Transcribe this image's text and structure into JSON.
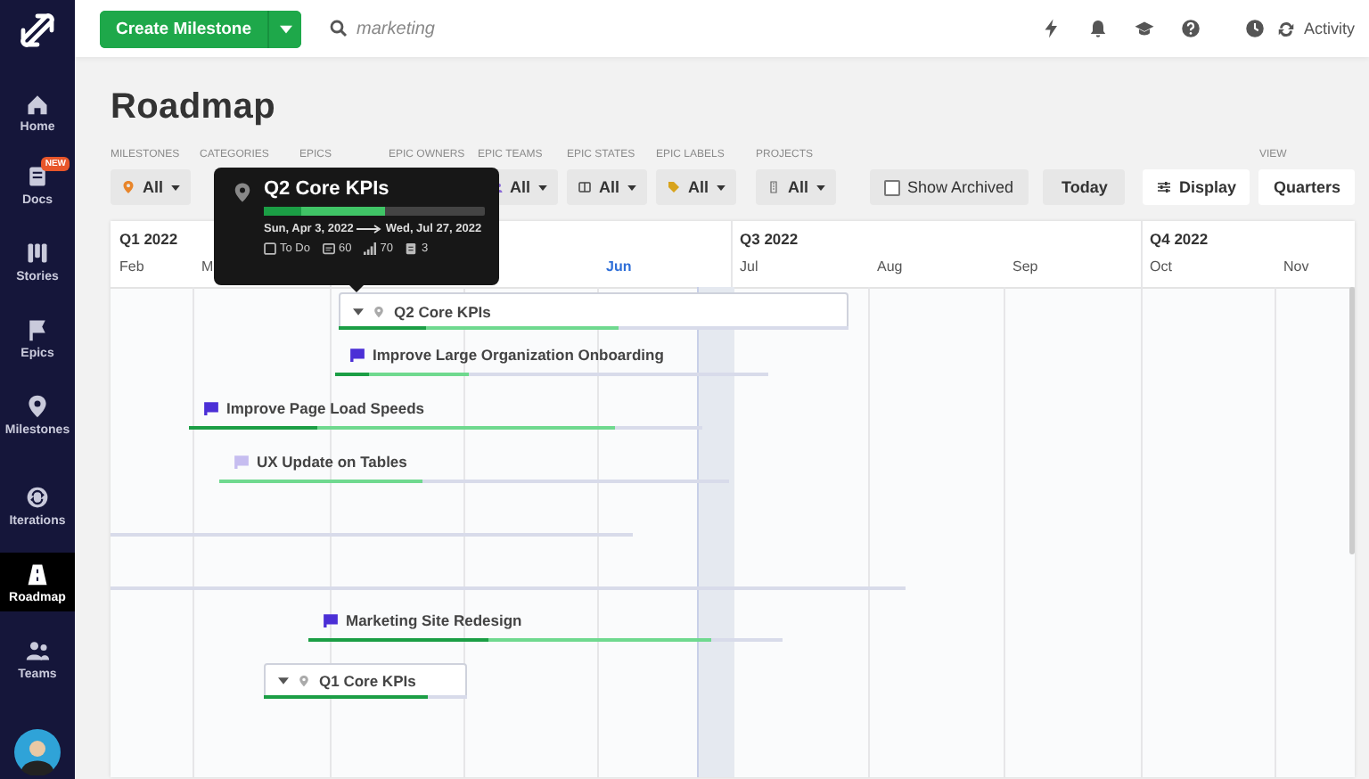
{
  "sidebar": {
    "items": [
      {
        "label": "Home",
        "selected": false
      },
      {
        "label": "Docs",
        "badge": "NEW",
        "selected": false
      },
      {
        "label": "Stories",
        "selected": false
      },
      {
        "label": "Epics",
        "selected": false
      },
      {
        "label": "Milestones",
        "selected": false
      },
      {
        "label": "Iterations",
        "selected": false
      },
      {
        "label": "Roadmap",
        "selected": true
      },
      {
        "label": "Teams",
        "selected": false
      }
    ]
  },
  "topbar": {
    "create_button": "Create Milestone",
    "search": {
      "placeholder": "marketing"
    },
    "activity": "Activity"
  },
  "page": {
    "title": "Roadmap",
    "filters": [
      {
        "label": "MILESTONES",
        "value": "All"
      },
      {
        "label": "CATEGORIES"
      },
      {
        "label": "EPICS"
      },
      {
        "label": "EPIC OWNERS"
      },
      {
        "label": "EPIC TEAMS",
        "value": "All"
      },
      {
        "label": "EPIC STATES",
        "value": "All"
      },
      {
        "label": "EPIC LABELS",
        "value": "All"
      },
      {
        "label": "PROJECTS",
        "value": "All"
      }
    ],
    "show_archived": {
      "label": "Show Archived",
      "checked": false
    },
    "today_button": "Today",
    "display_button": "Display",
    "view": {
      "label": "VIEW",
      "value": "Quarters"
    }
  },
  "timeline": {
    "quarters": [
      {
        "label": "Q1 2022"
      },
      {
        "label": "Q3 2022"
      },
      {
        "label": "Q4 2022"
      }
    ],
    "months": [
      {
        "label": "Feb",
        "current": false
      },
      {
        "label": "M",
        "current": false
      },
      {
        "label": "Jun",
        "current": true
      },
      {
        "label": "Jul",
        "current": false
      },
      {
        "label": "Aug",
        "current": false
      },
      {
        "label": "Sep",
        "current": false
      },
      {
        "label": "Oct",
        "current": false
      },
      {
        "label": "Nov",
        "current": false
      }
    ],
    "rows": [
      {
        "kind": "milestone",
        "name": "Q2 Core KPIs",
        "progress": [
          {
            "kind": "done",
            "level": 0.17
          },
          {
            "kind": "in_progress",
            "level": 0.55
          }
        ]
      },
      {
        "kind": "epic",
        "name": "Improve Large Organization Onboarding",
        "color": "#4b2fd6",
        "progress": [
          {
            "kind": "done",
            "level": 0.08
          },
          {
            "kind": "in_progress",
            "level": 0.31
          }
        ]
      },
      {
        "kind": "epic",
        "name": "Improve Page Load Speeds",
        "color": "#4b2fd6",
        "progress": [
          {
            "kind": "done",
            "level": 0.25
          },
          {
            "kind": "in_progress",
            "level": 0.83
          }
        ]
      },
      {
        "kind": "epic",
        "name": "UX Update on Tables",
        "color": "#c6bdf0",
        "progress": [
          {
            "kind": "in_progress",
            "level": 0.4
          }
        ]
      },
      {
        "kind": "line"
      },
      {
        "kind": "line"
      },
      {
        "kind": "epic",
        "name": "Marketing Site Redesign",
        "color": "#4b2fd6",
        "progress": [
          {
            "kind": "done",
            "level": 0.38
          },
          {
            "kind": "in_progress",
            "level": 0.85
          }
        ]
      },
      {
        "kind": "milestone",
        "name": "Q1 Core KPIs",
        "progress": [
          {
            "kind": "done",
            "level": 0.81
          },
          {
            "kind": "in_progress",
            "level": 0.81
          }
        ]
      }
    ]
  },
  "tooltip": {
    "title": "Q2 Core KPIs",
    "progress": [
      {
        "kind": "done",
        "level": 0.17
      },
      {
        "kind": "in_progress",
        "level": 0.55
      }
    ],
    "start": "Sun, Apr 3, 2022",
    "end": "Wed, Jul 27, 2022",
    "state": "To Do",
    "stats": [
      "60",
      "70",
      "3"
    ]
  }
}
